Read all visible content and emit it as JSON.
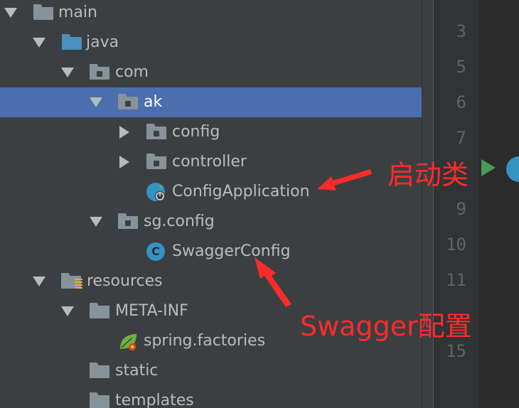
{
  "tree": {
    "items": [
      {
        "label": "main"
      },
      {
        "label": "java"
      },
      {
        "label": "com"
      },
      {
        "label": "ak"
      },
      {
        "label": "config"
      },
      {
        "label": "controller"
      },
      {
        "label": "ConfigApplication"
      },
      {
        "label": "sg.config"
      },
      {
        "label": "SwaggerConfig"
      },
      {
        "label": "resources"
      },
      {
        "label": "META-INF"
      },
      {
        "label": "spring.factories"
      },
      {
        "label": "static"
      },
      {
        "label": "templates"
      }
    ],
    "selected_item": "ak"
  },
  "icons": {
    "class_letter": "C"
  },
  "gutter": {
    "line_numbers": [
      "3",
      "5",
      "6",
      "7",
      "9",
      "10",
      "11",
      "15"
    ]
  },
  "annotations": {
    "startup_class": "启动类",
    "swagger_config": "Swagger配置"
  },
  "colors": {
    "selection": "#4b6eaf",
    "annotation": "#ff2b2b",
    "class_icon": "#3592c4",
    "run_icon": "#499c54"
  }
}
